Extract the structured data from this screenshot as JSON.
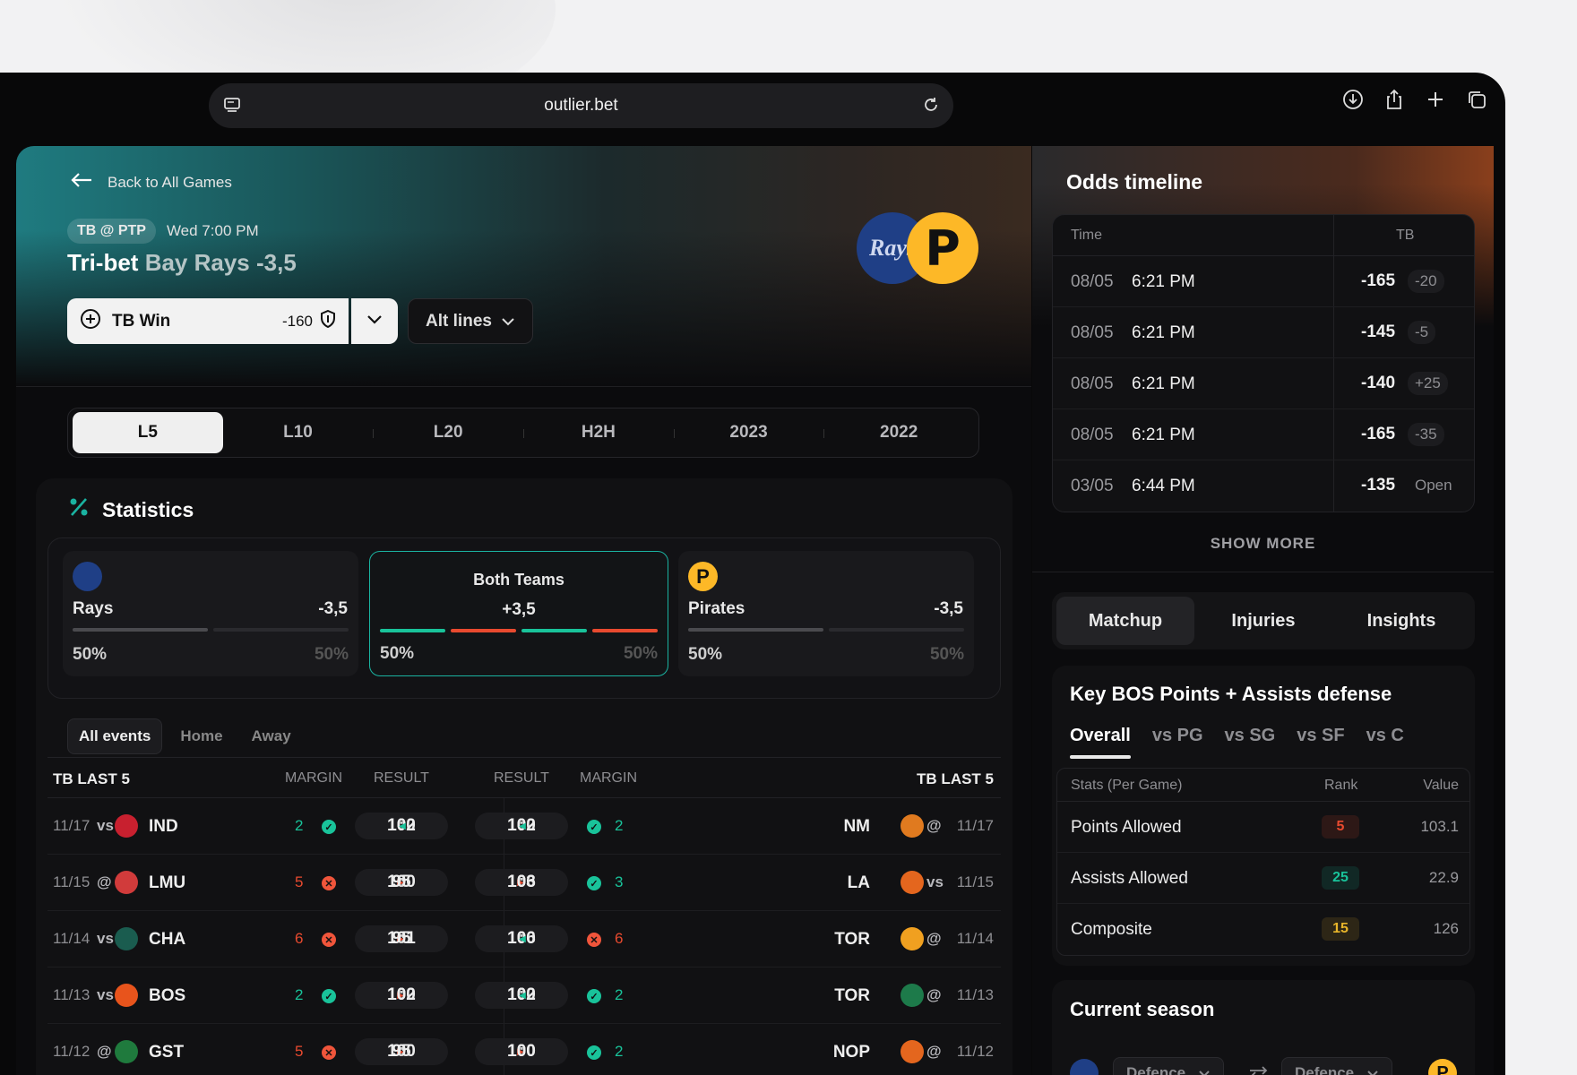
{
  "browser": {
    "url": "outlier.bet"
  },
  "header": {
    "back_label": "Back to All Games",
    "matchup_tag": "TB @ PTP",
    "game_time": "Wed 7:00 PM",
    "title_main": "Tri-bet",
    "title_sub": "Bay Rays -3,5",
    "bet_label": "TB Win",
    "bet_odds": "-160",
    "alt_lines": "Alt lines",
    "logo_rays": "Rays",
    "logo_pirates": "P"
  },
  "range_tabs": [
    "L5",
    "L10",
    "L20",
    "H2H",
    "2023",
    "2022"
  ],
  "statistics": {
    "title": "Statistics",
    "cards": [
      {
        "name": "Rays",
        "line": "-3,5",
        "pct_left": "50%",
        "pct_right": "50%"
      },
      {
        "name": "Both Teams",
        "line": "+3,5",
        "pct_left": "50%",
        "pct_right": "50%"
      },
      {
        "name": "Pirates",
        "line": "-3,5",
        "pct_left": "50%",
        "pct_right": "50%"
      }
    ],
    "filters": [
      "All events",
      "Home",
      "Away"
    ],
    "headers": {
      "left_team": "TB LAST 5",
      "margin": "MARGIN",
      "result": "RESULT",
      "right_team": "TB LAST 5"
    },
    "rows": [
      {
        "l_date": "11/17",
        "l_loc": "vs",
        "l_team": "IND",
        "l_logo": "#c8202f",
        "l_margin": "2",
        "l_win": true,
        "l_s1": "100",
        "l_s2": "102",
        "l_lead": "right",
        "r_s1": "100",
        "r_s2": "102",
        "r_lead": "right",
        "r_win": true,
        "r_margin": "2",
        "r_team": "NM",
        "r_logo": "#e07a1f",
        "r_loc": "@",
        "r_date": "11/17"
      },
      {
        "l_date": "11/15",
        "l_loc": "@",
        "l_team": "LMU",
        "l_logo": "#d13b3b",
        "l_margin": "5",
        "l_win": false,
        "l_s1": "100",
        "l_s2": "95",
        "l_lead": "left",
        "r_s1": "106",
        "r_s2": "103",
        "r_lead": "left",
        "r_win": true,
        "r_margin": "3",
        "r_team": "LA",
        "r_logo": "#e4661e",
        "r_loc": "vs",
        "r_date": "11/15"
      },
      {
        "l_date": "11/14",
        "l_loc": "vs",
        "l_team": "CHA",
        "l_logo": "#1a5c4f",
        "l_margin": "6",
        "l_win": false,
        "l_s1": "101",
        "l_s2": "95",
        "l_lead": "left",
        "r_s1": "100",
        "r_s2": "106",
        "r_lead": "right",
        "r_win": false,
        "r_margin": "6",
        "r_team": "TOR",
        "r_logo": "#f0a020",
        "r_loc": "@",
        "r_date": "11/14"
      },
      {
        "l_date": "11/13",
        "l_loc": "vs",
        "l_team": "BOS",
        "l_logo": "#e8541c",
        "l_margin": "2",
        "l_win": true,
        "l_s1": "102",
        "l_s2": "100",
        "l_lead": "left",
        "r_s1": "100",
        "r_s2": "102",
        "r_lead": "right",
        "r_win": true,
        "r_margin": "2",
        "r_team": "TOR",
        "r_logo": "#1d7a4a",
        "r_loc": "@",
        "r_date": "11/13"
      },
      {
        "l_date": "11/12",
        "l_loc": "@",
        "l_team": "GST",
        "l_logo": "#1f7a3d",
        "l_margin": "5",
        "l_win": false,
        "l_s1": "100",
        "l_s2": "95",
        "l_lead": "left",
        "r_s1": "100",
        "r_s2": "100",
        "r_lead": "left",
        "r_win": true,
        "r_margin": "2",
        "r_team": "NOP",
        "r_logo": "#e4661e",
        "r_loc": "@",
        "r_date": "11/12"
      }
    ]
  },
  "odds": {
    "title": "Odds timeline",
    "headers": {
      "time": "Time",
      "team": "TB"
    },
    "rows": [
      {
        "date": "08/05",
        "time": "6:21 PM",
        "odds": "-165",
        "change": "-20"
      },
      {
        "date": "08/05",
        "time": "6:21 PM",
        "odds": "-145",
        "change": "-5"
      },
      {
        "date": "08/05",
        "time": "6:21 PM",
        "odds": "-140",
        "change": "+25"
      },
      {
        "date": "08/05",
        "time": "6:21 PM",
        "odds": "-165",
        "change": "-35"
      },
      {
        "date": "03/05",
        "time": "6:44 PM",
        "odds": "-135",
        "change": "Open"
      }
    ],
    "show_more": "SHOW MORE"
  },
  "matchup_tabs": [
    "Matchup",
    "Injuries",
    "Insights"
  ],
  "defense": {
    "title": "Key BOS Points + Assists defense",
    "tabs": [
      "Overall",
      "vs PG",
      "vs SG",
      "vs SF",
      "vs C"
    ],
    "headers": {
      "stat": "Stats (Per Game)",
      "rank": "Rank",
      "value": "Value"
    },
    "rows": [
      {
        "stat": "Points Allowed",
        "rank": "5",
        "value": "103.1",
        "color": "#e84a2f"
      },
      {
        "stat": "Assists Allowed",
        "rank": "25",
        "value": "22.9",
        "color": "#19c39a"
      },
      {
        "stat": "Composite",
        "rank": "15",
        "value": "126",
        "color": "#e8b52a"
      }
    ]
  },
  "current_season": {
    "title": "Current season",
    "select_left": "Defence",
    "select_right": "Defence"
  }
}
